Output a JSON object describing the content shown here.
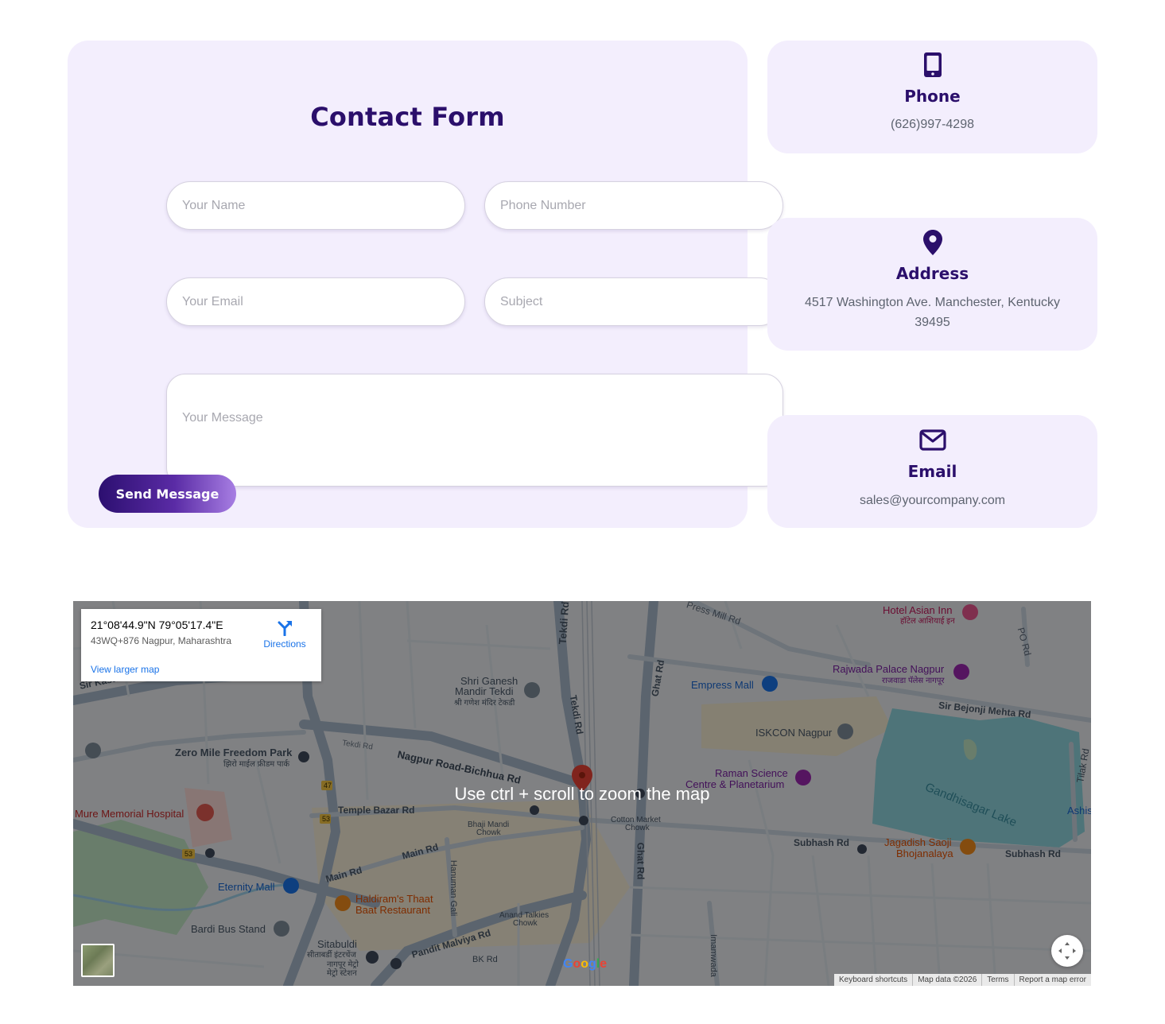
{
  "contact_form": {
    "title": "Contact Form",
    "name_placeholder": "Your Name",
    "phone_placeholder": "Phone Number",
    "email_placeholder": "Your Email",
    "subject_placeholder": "Subject",
    "message_placeholder": "Your Message",
    "submit_label": "Send Message"
  },
  "info_cards": {
    "phone": {
      "icon": "mobile-phone-icon",
      "title": "Phone",
      "text": "(626)997-4298"
    },
    "address": {
      "icon": "map-pin-icon",
      "title": "Address",
      "text": "4517 Washington Ave. Manchester, Kentucky 39495"
    },
    "email": {
      "icon": "envelope-icon",
      "title": "Email",
      "text": "sales@yourcompany.com"
    }
  },
  "map": {
    "coords": "21°08'44.9\"N 79°05'17.4\"E",
    "address": "43WQ+876 Nagpur, Maharashtra",
    "directions_label": "Directions",
    "view_larger_label": "View larger map",
    "zoom_hint": "Use ctrl + scroll to zoom the map",
    "google_label": "Google",
    "attribution": [
      "Keyboard shortcuts",
      "Map data ©2026",
      "Terms",
      "Report a map error"
    ],
    "labels": {
      "hotel_asian_inn": "Hotel Asian Inn",
      "hotel_asian_inn_hi": "हॉटेल आशियाई इन",
      "press_mill_rd": "Press Mill Rd",
      "po_rd": "PO Rd",
      "tekdi_rd": "Tekdi Rd",
      "rajwada": "Rajwada Palace Nagpur",
      "rajwada_hi": "राजवाडा पॅलेस नागपूर",
      "shri_ganesh": "Shri Ganesh",
      "mandir_tekdi": "Mandir Tekdi",
      "ganesh_hi": "श्री गणेश मंदिर टेकडी",
      "empress_mall": "Empress Mall",
      "ghat_rd": "Ghat Rd",
      "sir_kasturchand": "Sir Kasturchand Daga R",
      "sir_bejonji": "Sir Bejonji Mehta Rd",
      "iskcon": "ISKCON Nagpur",
      "zero_mile": "Zero Mile Freedom Park",
      "zero_mile_hi": "झिरो माईल फ्रीडम पार्क",
      "nagpur_road": "Nagpur Road-Bichhua Rd",
      "raman_science": "Raman Science",
      "centre_planetarium": "Centre & Planetarium",
      "gandhisagar": "Gandhisagar Lake",
      "tilak_rd": "Tilak Rd",
      "mure_hospital": "Mure Memorial Hospital",
      "temple_bazar": "Temple Bazar Rd",
      "bhaji_mandi": "Bhaji Mandi",
      "chowk": "Chowk",
      "cotton_market": "Cotton Market",
      "subhash_rd": "Subhash Rd",
      "jagadish_saoji": "Jagadish Saoji",
      "bhojanalaya": "Bhojanalaya",
      "main_rd": "Main Rd",
      "hanuman_gali": "Hanuman Gali",
      "eternity_mall": "Eternity Mall",
      "haldiram": "Haldiram's Thaat",
      "baat_restaurant": "Baat Restaurant",
      "bardi_bus": "Bardi Bus Stand",
      "anand_talkies": "Anand Talkies",
      "sitabuldi": "Sitabuldi",
      "sitabuldi_hi1": "सीताबर्डी इंटरचेंज",
      "sitabuldi_hi2": "नागपूर मेट्रो",
      "sitabuldi_hi3": "मेट्रो स्टेशन",
      "pandit_malviya": "Pandit Malviya Rd",
      "bk_rd": "BK Rd",
      "imamwada": "Imamwada",
      "ashis": "Ashis",
      "num_47": "47",
      "num_53": "53",
      "tekdi_rd_small": "Tekdi Rd"
    }
  },
  "colors": {
    "brand_dark": "#2b0f6b",
    "card_bg": "#f3eefd",
    "button_gradient_start": "#2c0f70",
    "button_gradient_end": "#a77ee3"
  }
}
